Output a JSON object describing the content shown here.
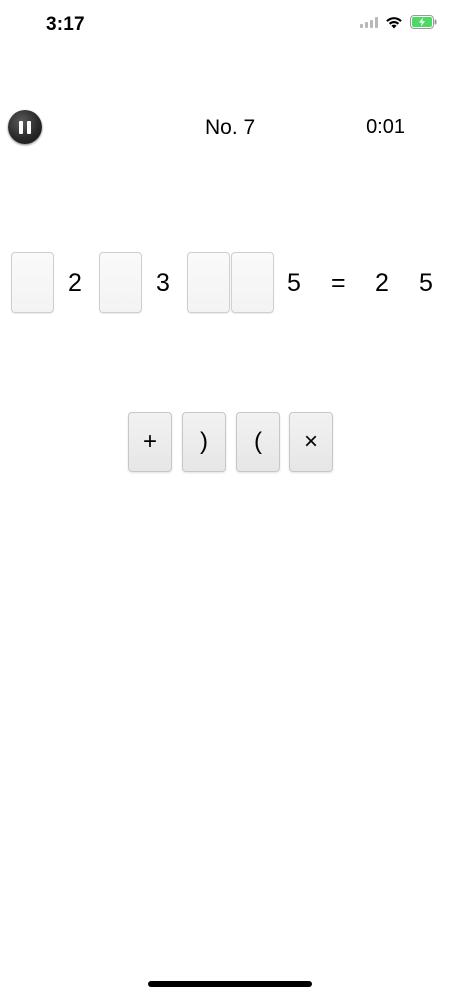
{
  "status_bar": {
    "time": "3:17"
  },
  "header": {
    "level": "No. 7",
    "timer": "0:01"
  },
  "equation": {
    "tokens": [
      "2",
      "3",
      "5",
      "=",
      "2",
      "5"
    ]
  },
  "operators": [
    "+",
    ")",
    "(",
    "×"
  ],
  "colors": {
    "battery": "#4cd964",
    "tile_border": "#c7c7c7"
  },
  "icons": {
    "pause": "pause-icon",
    "wifi": "wifi-icon",
    "battery": "battery-icon"
  }
}
